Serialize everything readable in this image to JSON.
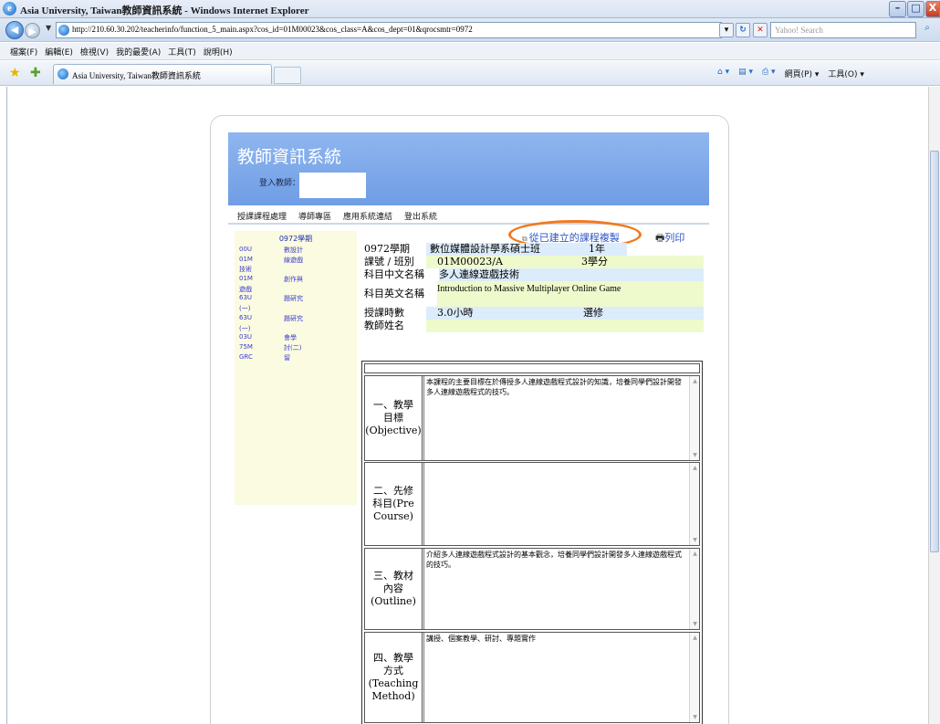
{
  "window": {
    "title": "Asia University, Taiwan教師資訊系統 - Windows Internet Explorer",
    "buttons": {
      "minimize": "–",
      "maximize": "□",
      "close": "X"
    }
  },
  "addressbar": {
    "url": "http://210.60.30.202/teacherinfo/function_5_main.aspx?cos_id=01M00023&cos_class=A&cos_dept=01&qrocsmtr=0972",
    "search_placeholder": "Yahoo! Search"
  },
  "menubar": {
    "items": [
      "檔案(F)",
      "編輯(E)",
      "檢視(V)",
      "我的最愛(A)",
      "工具(T)",
      "說明(H)"
    ]
  },
  "tabs": {
    "active_title": "Asia University, Taiwan教師資訊系統",
    "commands": [
      "網頁(P) ▾",
      "工具(O) ▾"
    ]
  },
  "page": {
    "system_name": "教師資訊系統",
    "login_label": "登入教師：",
    "nav": [
      "授課課程處理",
      "導師專區",
      "應用系統連結",
      "登出系統"
    ],
    "term_title": "0972學期",
    "courses": [
      {
        "code": "00U",
        "name": "數設計"
      },
      {
        "code": "01M",
        "name": "線遊戲"
      },
      {
        "code": "技術",
        "name": ""
      },
      {
        "code": "01M",
        "name": "創作與"
      },
      {
        "code": "遊戲",
        "name": ""
      },
      {
        "code": "63U",
        "name": "題研究"
      },
      {
        "code": "(一)",
        "name": ""
      },
      {
        "code": "63U",
        "name": "題研究"
      },
      {
        "code": "(一)",
        "name": ""
      },
      {
        "code": "03U",
        "name": "會學"
      },
      {
        "code": "75M",
        "name": "討(二)"
      },
      {
        "code": "GRC",
        "name": "留"
      }
    ],
    "copy_link": "從已建立的課程複製",
    "print_link": "列印",
    "info": {
      "term": "0972學期",
      "dept": "數位媒體設計學系碩士班",
      "year": "1年",
      "class_label": "課號 / 班別",
      "class_value": "01M00023/A",
      "credits": "3學分",
      "cname_label": "科目中文名稱",
      "cname_value": "多人連線遊戲技術",
      "ename_label": "科目英文名稱",
      "ename_value": "Introduction to Massive Multiplayer Online Game",
      "hours_label": "授課時數",
      "hours_value": "3.0小時",
      "type": "選修",
      "teacher_label": "教師姓名"
    },
    "syllabus": [
      {
        "label": [
          "一、教學",
          "目標",
          "(Objective)"
        ],
        "text": "本課程的主要目標在於傳授多人連線遊戲程式設計的知識，培養同學們設計開發多人連線遊戲程式的技巧。"
      },
      {
        "label": [
          "二、先修",
          "科目(Pre",
          "Course)"
        ],
        "text": ""
      },
      {
        "label": [
          "三、教材",
          "內容",
          "(Outline)"
        ],
        "text": "介紹多人連線遊戲程式設計的基本觀念，培養同學們設計開發多人連線遊戲程式的技巧。"
      },
      {
        "label": [
          "四、教學",
          "方式",
          "(Teaching",
          "Method)"
        ],
        "text": "講授、個案教學、研討、專題實作"
      }
    ]
  }
}
